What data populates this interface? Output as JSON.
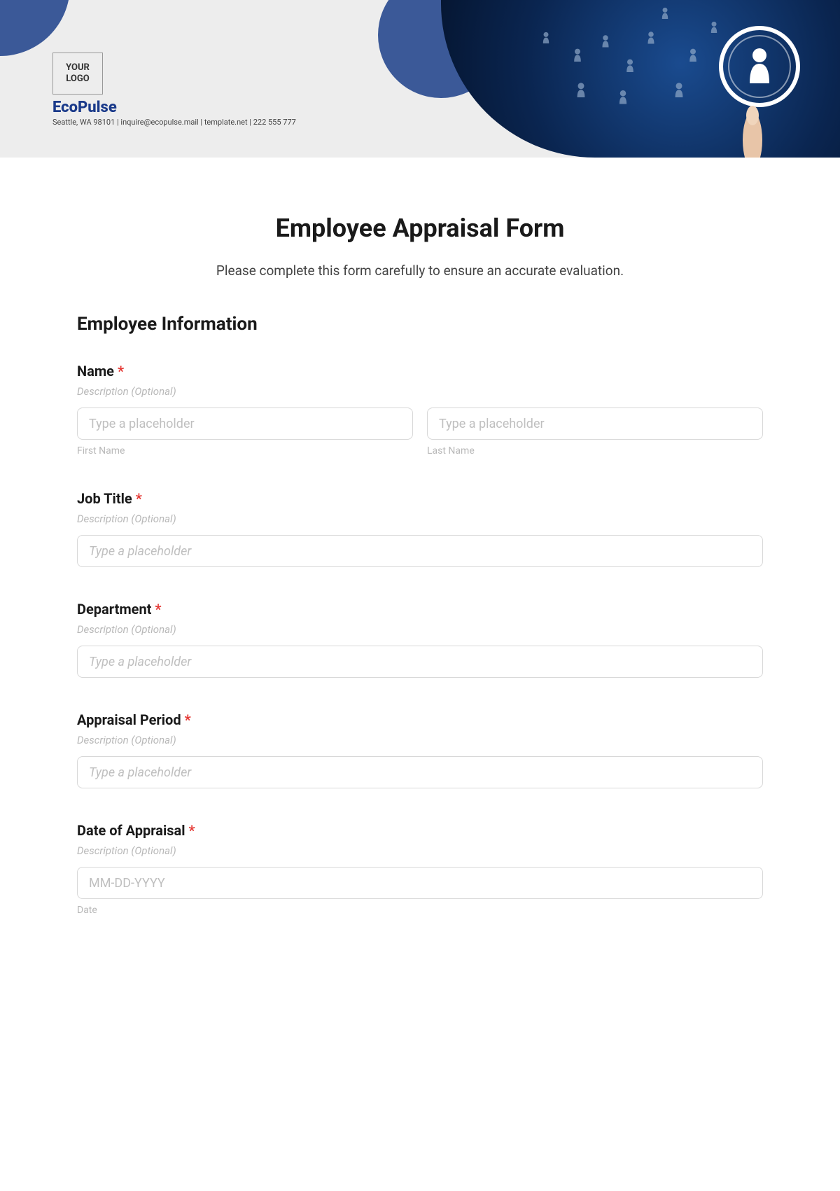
{
  "header": {
    "logo_text": "YOUR LOGO",
    "brand": "EcoPulse",
    "tagline": "Seattle, WA 98101 | inquire@ecopulse.mail | template.net | 222 555 777"
  },
  "form": {
    "title": "Employee Appraisal Form",
    "subtitle": "Please complete this form carefully to ensure an accurate evaluation.",
    "section_title": "Employee Information",
    "fields": {
      "name": {
        "label": "Name",
        "desc": "Description (Optional)",
        "first_placeholder": "Type a placeholder",
        "first_sub": "First Name",
        "last_placeholder": "Type a placeholder",
        "last_sub": "Last Name"
      },
      "job_title": {
        "label": "Job Title",
        "desc": "Description (Optional)",
        "placeholder": "Type a placeholder"
      },
      "department": {
        "label": "Department",
        "desc": "Description (Optional)",
        "placeholder": "Type a placeholder"
      },
      "appraisal_period": {
        "label": "Appraisal Period",
        "desc": "Description (Optional)",
        "placeholder": "Type a placeholder"
      },
      "date_of_appraisal": {
        "label": "Date of Appraisal",
        "desc": "Description (Optional)",
        "placeholder": "MM-DD-YYYY",
        "sub": "Date"
      }
    },
    "required_marker": "*"
  }
}
